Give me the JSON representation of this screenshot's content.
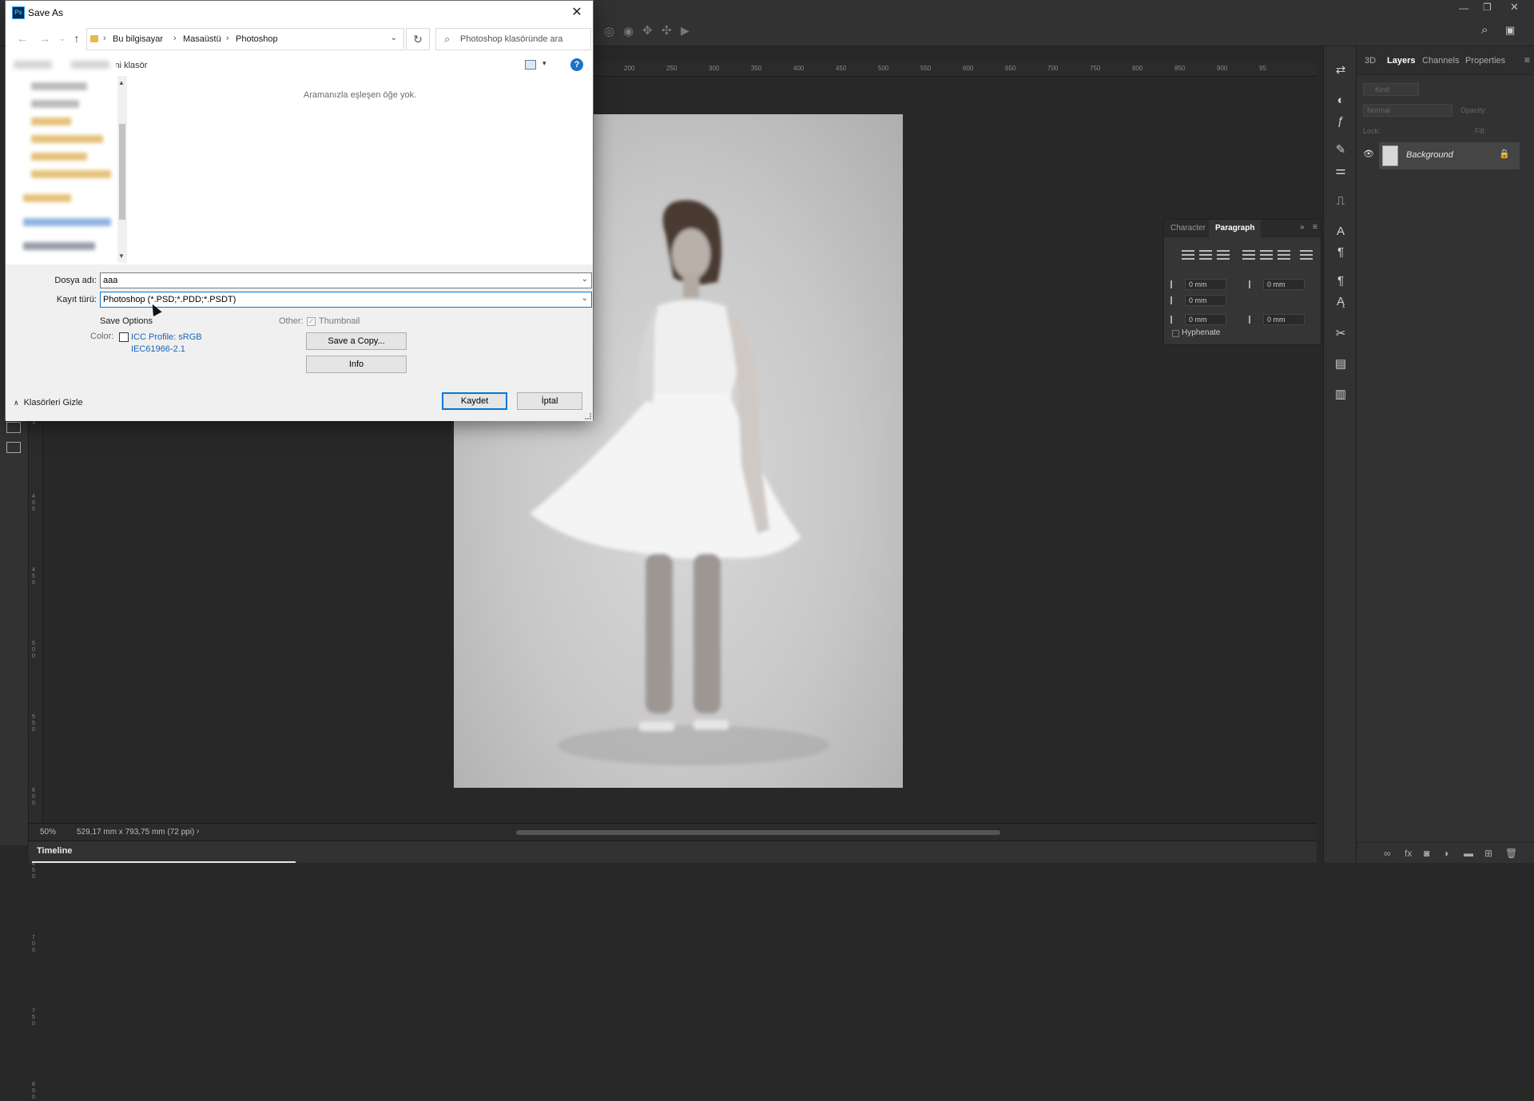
{
  "dialog": {
    "title": "Save As",
    "app_icon_text": "Ps",
    "close_glyph": "✕",
    "breadcrumbs": [
      "Bu bilgisayar",
      "Masaüstü",
      "Photoshop"
    ],
    "search_placeholder": "Photoshop klasöründe ara",
    "new_folder_label": "Yeni klasör",
    "empty_message": "Aramanızla eşleşen öğe yok.",
    "filename_label": "Dosya adı:",
    "filename_value": "aaa",
    "filetype_label": "Kayıt türü:",
    "filetype_value": "Photoshop (*.PSD;*.PDD;*.PSDT)",
    "save_options_title": "Save Options",
    "other_label": "Other:",
    "thumbnail_label": "Thumbnail",
    "thumbnail_checked": true,
    "color_label": "Color:",
    "icc_profile_label": "ICC Profile:  sRGB IEC61966-2.1",
    "icc_checked": false,
    "save_copy_button": "Save a Copy...",
    "info_button": "Info",
    "save_button": "Kaydet",
    "cancel_button": "İptal",
    "hide_folders_label": "Klasörleri Gizle",
    "help_glyph": "?"
  },
  "photoshop": {
    "ruler_top_ticks": [
      "200",
      "250",
      "300",
      "350",
      "400",
      "450",
      "500",
      "550",
      "600",
      "650",
      "700",
      "750",
      "800",
      "850",
      "900",
      "95"
    ],
    "ruler_left_ticks": [
      "3",
      "4 0 0",
      "4 5 0",
      "5 0 0",
      "5 5 0",
      "6 0 0",
      "6 5 0",
      "7 0 0",
      "7 5 0",
      "8 0 0"
    ],
    "status_zoom": "50%",
    "status_doc_size": "529,17 mm x 793,75 mm (72 ppi)",
    "timeline_tab": "Timeline",
    "layers_panel": {
      "tabs": [
        "3D",
        "Layers",
        "Channels",
        "Properties"
      ],
      "active_tab": "Layers",
      "kind_placeholder": "Kind",
      "blend_mode": "Normal",
      "opacity_label": "Opacity:",
      "lock_label": "Lock:",
      "fill_label": "Fill:",
      "layer_name": "Background"
    },
    "paragraph_panel": {
      "tabs": [
        "Character",
        "Paragraph"
      ],
      "active_tab": "Paragraph",
      "indent_left": "0 mm",
      "indent_right": "0 mm",
      "indent_first": "0 mm",
      "space_before": "0 mm",
      "space_after": "0 mm",
      "hyphenate_label": "Hyphenate"
    }
  }
}
